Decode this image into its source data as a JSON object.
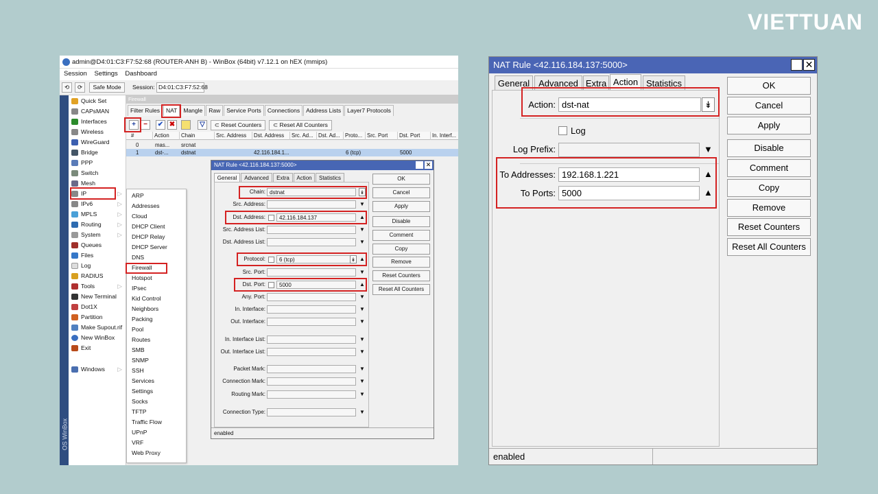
{
  "brand": "VIETTUAN",
  "winbox": {
    "title": "admin@D4:01:C3:F7:52:68 (ROUTER-ANH B) - WinBox (64bit) v7.12.1 on hEX (mmips)",
    "menu": [
      "Session",
      "Settings",
      "Dashboard"
    ],
    "safe_mode": "Safe Mode",
    "session_label": "Session:",
    "session_value": "D4:01:C3:F7:52:68",
    "side_text": "OS WinBox",
    "nav": [
      "Quick Set",
      "CAPsMAN",
      "Interfaces",
      "Wireless",
      "WireGuard",
      "Bridge",
      "PPP",
      "Switch",
      "Mesh",
      "IP",
      "IPv6",
      "MPLS",
      "Routing",
      "System",
      "Queues",
      "Files",
      "Log",
      "RADIUS",
      "Tools",
      "New Terminal",
      "Dot1X",
      "Partition",
      "Make Supout.rif",
      "New WinBox",
      "Exit",
      "Windows"
    ],
    "ip_submenu": [
      "ARP",
      "Addresses",
      "Cloud",
      "DHCP Client",
      "DHCP Relay",
      "DHCP Server",
      "DNS",
      "Firewall",
      "Hotspot",
      "IPsec",
      "Kid Control",
      "Neighbors",
      "Packing",
      "Pool",
      "Routes",
      "SMB",
      "SNMP",
      "SSH",
      "Services",
      "Settings",
      "Socks",
      "TFTP",
      "Traffic Flow",
      "UPnP",
      "VRF",
      "Web Proxy"
    ],
    "firewall": {
      "header": "Firewall",
      "tabs": [
        "Filter Rules",
        "NAT",
        "Mangle",
        "Raw",
        "Service Ports",
        "Connections",
        "Address Lists",
        "Layer7 Protocols"
      ],
      "reset_counters": "Reset Counters",
      "reset_all_counters": "Reset All Counters",
      "columns": [
        "#",
        "Action",
        "Chain",
        "Src. Address",
        "Dst. Address",
        "Src. Ad...",
        "Dst. Ad...",
        "Proto...",
        "Src. Port",
        "Dst. Port",
        "In. Interf..."
      ],
      "rows": [
        {
          "num": "0",
          "action": "mas...",
          "chain": "srcnat",
          "dst": "",
          "proto": "",
          "dport": ""
        },
        {
          "num": "1",
          "action": "dst-...",
          "chain": "dstnat",
          "dst": "42.116.184.1...",
          "proto": "6 (tcp)",
          "dport": "5000"
        }
      ]
    }
  },
  "small_dialog": {
    "title": "NAT Rule <42.116.184.137:5000>",
    "tabs": [
      "General",
      "Advanced",
      "Extra",
      "Action",
      "Statistics"
    ],
    "fields": {
      "chain_label": "Chain:",
      "chain": "dstnat",
      "src_address_label": "Src. Address:",
      "dst_address_label": "Dst. Address:",
      "dst_address": "42.116.184.137",
      "src_address_list_label": "Src. Address List:",
      "dst_address_list_label": "Dst. Address List:",
      "protocol_label": "Protocol:",
      "protocol": "6 (tcp)",
      "src_port_label": "Src. Port:",
      "dst_port_label": "Dst. Port:",
      "dst_port": "5000",
      "any_port_label": "Any. Port:",
      "in_interface_label": "In. Interface:",
      "out_interface_label": "Out. Interface:",
      "in_interface_list_label": "In. Interface List:",
      "out_interface_list_label": "Out. Interface List:",
      "packet_mark_label": "Packet Mark:",
      "connection_mark_label": "Connection Mark:",
      "routing_mark_label": "Routing Mark:",
      "connection_type_label": "Connection Type:"
    },
    "buttons": [
      "OK",
      "Cancel",
      "Apply",
      "Disable",
      "Comment",
      "Copy",
      "Remove",
      "Reset Counters",
      "Reset All Counters"
    ],
    "status": "enabled"
  },
  "big_dialog": {
    "title": "NAT Rule <42.116.184.137:5000>",
    "tabs": [
      "General",
      "Advanced",
      "Extra",
      "Action",
      "Statistics"
    ],
    "action_label": "Action:",
    "action_value": "dst-nat",
    "log_label": "Log",
    "log_prefix_label": "Log Prefix:",
    "to_addresses_label": "To Addresses:",
    "to_addresses_value": "192.168.1.221",
    "to_ports_label": "To Ports:",
    "to_ports_value": "5000",
    "buttons": [
      "OK",
      "Cancel",
      "Apply",
      "Disable",
      "Comment",
      "Copy",
      "Remove",
      "Reset Counters",
      "Reset All Counters"
    ],
    "status": "enabled"
  },
  "colors": {
    "background": "#b2cccd",
    "title_blue": "#4a65b5",
    "highlight_red": "#d42121",
    "selected_row": "#b9d1ee"
  }
}
